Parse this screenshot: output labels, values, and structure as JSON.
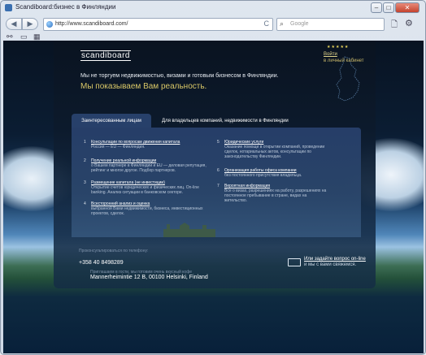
{
  "window": {
    "title": "Scandiboard:бизнес в Финляндии",
    "controls": {
      "minimize": "–",
      "maximize": "□",
      "close": "✕"
    }
  },
  "nav": {
    "back": "◀",
    "forward": "▶",
    "url": "http://www.scandiboard.com/",
    "reload": "C",
    "search_placeholder": "Google",
    "toolbar_icons": [
      "page-icon",
      "settings-icon"
    ]
  },
  "site": {
    "logo": "scandiboard",
    "login_link": "Войти",
    "login_sub": "в личный кабинет",
    "tagline_1": "Мы не торгуем недвижимостью, визами и готовым бизнесом в Финляндии.",
    "tagline_2": "Мы показываем Вам реальность.",
    "tabs": [
      {
        "label": "Заинтересованным лицам"
      },
      {
        "label": "Для владельцев компаний, недвижимости в Финляндии"
      }
    ],
    "left_items": [
      {
        "num": "1",
        "title": "Консультации по вопросам движения капитала",
        "text": "Россия — EU — Финляндия."
      },
      {
        "num": "2",
        "title": "Получение реальной информации",
        "text": "о Вашем партнере в Финляндии и EU — деловая репутация, рейтинг и многое другое. Подбор партнеров."
      },
      {
        "num": "3",
        "title": "Размещение капитала (не инвестиции)",
        "text": "Открытие счетов юридических и физических лиц. On-line banking. Анализ ситуации в банковском секторе."
      },
      {
        "num": "4",
        "title": "Всесторонний анализ и оценка",
        "text": "выбранной Вами недвижимости, бизнеса, инвестиционных проектов, сделок."
      }
    ],
    "right_items": [
      {
        "num": "5",
        "title": "Юридические услуги",
        "text": "Оказание помощи в открытии компаний, проведении сделок, нотариальных актов, консультации по законодательству Финляндии."
      },
      {
        "num": "6",
        "title": "Организация работы офиса компании",
        "text": "без постоянного присутствия владельца."
      },
      {
        "num": "7",
        "title": "Вероятная информация",
        "text": "Все о визах, разрешениях на работу, разрешениях на постоянное пребывание в стране, видах на жительство."
      }
    ],
    "contact_note": "Проконсультироваться по телефону:",
    "phone": "+358 40 8498289",
    "office_note": "Приглашаем в гости, мы готовим очень вкусный кофе",
    "address": "Mannerheimintie 12 B, 00100 Helsinki, Finland",
    "ask_title": "Или задайте вопрос on-line",
    "ask_sub": "и мы с вами свяжемся."
  }
}
